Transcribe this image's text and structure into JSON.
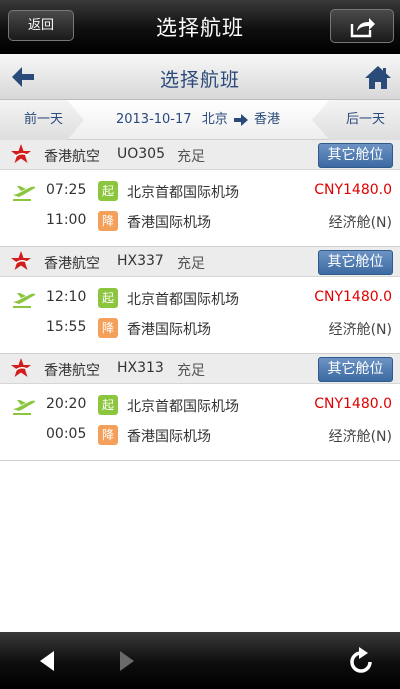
{
  "topbar": {
    "title": "选择航班",
    "back_label": "返回"
  },
  "subheader": {
    "title": "选择航班"
  },
  "datebar": {
    "prev_label": "前一天",
    "next_label": "后一天",
    "date": "2013-10-17",
    "from": "北京",
    "to": "香港"
  },
  "flights": [
    {
      "airline": "香港航空",
      "flight_no": "UO305",
      "availability": "充足",
      "other_cabin_label": "其它舱位",
      "dep_time": "07:25",
      "dep_tag": "起",
      "dep_airport": "北京首都国际机场",
      "arr_time": "11:00",
      "arr_tag": "降",
      "arr_airport": "香港国际机场",
      "price": "CNY1480.0",
      "cabin": "经济舱(N)"
    },
    {
      "airline": "香港航空",
      "flight_no": "HX337",
      "availability": "充足",
      "other_cabin_label": "其它舱位",
      "dep_time": "12:10",
      "dep_tag": "起",
      "dep_airport": "北京首都国际机场",
      "arr_time": "15:55",
      "arr_tag": "降",
      "arr_airport": "香港国际机场",
      "price": "CNY1480.0",
      "cabin": "经济舱(N)"
    },
    {
      "airline": "香港航空",
      "flight_no": "HX313",
      "availability": "充足",
      "other_cabin_label": "其它舱位",
      "dep_time": "20:20",
      "dep_tag": "起",
      "dep_airport": "北京首都国际机场",
      "arr_time": "00:05",
      "arr_tag": "降",
      "arr_airport": "香港国际机场",
      "price": "CNY1480.0",
      "cabin": "经济舱(N)"
    }
  ],
  "colors": {
    "accent_blue": "#3c6aa2",
    "price_red": "#e00000",
    "takeoff_green": "#8cc63f",
    "land_orange": "#f5a05a"
  },
  "icons": [
    "share-icon",
    "back-arrow-icon",
    "home-icon",
    "airline-logo-icon",
    "plane-takeoff-icon",
    "route-arrow-icon",
    "nav-back-icon",
    "nav-forward-icon",
    "refresh-icon"
  ]
}
